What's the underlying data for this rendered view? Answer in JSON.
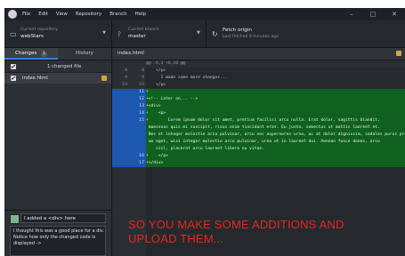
{
  "menu": [
    "File",
    "Edit",
    "View",
    "Repository",
    "Branch",
    "Help"
  ],
  "window_controls": [
    "–",
    "□",
    "✕"
  ],
  "toolbar": {
    "repo_caption": "Current repository",
    "repo_value": "webStars",
    "branch_caption": "Current branch",
    "branch_value": "master",
    "fetch_title": "Fetch origin",
    "fetch_sub": "Last fetched 8 minutes ago"
  },
  "sidebar": {
    "tab_changes": "Changes",
    "tab_changes_count": "1",
    "tab_history": "History",
    "summary": "1 changed file",
    "file": "index.html",
    "commit_summary": "I added a <div> here",
    "commit_description": [
      "I thought this was a good place for a div.",
      "Notice how only the changed code is",
      "displayed ->"
    ]
  },
  "diff": {
    "filename": "index.html",
    "hunk": "@@ -8,3 +8,10 @@",
    "lines": [
      {
        "old": "8",
        "new": "8",
        "text": "    </p>",
        "type": "ctx"
      },
      {
        "old": "9",
        "new": "9",
        "text": "      I made some more changes...",
        "type": "ctx"
      },
      {
        "old": "10",
        "new": "10",
        "text": "    </p>",
        "type": "ctx"
      },
      {
        "old": "",
        "new": "11",
        "text": "+",
        "type": "add"
      },
      {
        "old": "",
        "new": "12",
        "text": "+<!-- Later on... -->",
        "type": "add"
      },
      {
        "old": "",
        "new": "13",
        "text": "+<div>",
        "type": "add"
      },
      {
        "old": "",
        "new": "14",
        "text": "+    <p>",
        "type": "add"
      },
      {
        "old": "",
        "new": "15",
        "text": "+        Lorem ipsum dolor sit amet, pretium facilisi arcu nulla. Erat dolor, sagittis blandit,",
        "type": "add"
      },
      {
        "old": "",
        "new": "",
        "text": " maecenas quis mi suscipit, risus enim tincidunt erat. Eu justo, semectus ut mattis laoreet et.",
        "type": "addcont"
      },
      {
        "old": "",
        "new": "",
        "text": " Nec et integer molestie arcu pulvinar, arcu nec aspernores urna, ac at dolor dignissim, sodales purus pretium",
        "type": "addcont"
      },
      {
        "old": "",
        "new": "",
        "text": " um eget, wisi integer molestie arcu pulvinar, urna ut in laoreet dui. Aenean fusce donec, arcu",
        "type": "addcont"
      },
      {
        "old": "",
        "new": "",
        "text": "    nisl, placerat arcu laoreet libero eu vitae.",
        "type": "addcont"
      },
      {
        "old": "",
        "new": "16",
        "text": "+    </p>",
        "type": "add"
      },
      {
        "old": "",
        "new": "17",
        "text": "+</div>",
        "type": "add"
      }
    ]
  },
  "overlay": [
    "SO YOU MAKE SOME ADDITIONS AND",
    "UPLOAD THEM..."
  ],
  "colors": {
    "accent": "#2f81f7",
    "added_bg": "#10611f",
    "gutter_added": "#1c57b0",
    "overlay_text": "#e8251c",
    "badge_modified": "#d8a13a"
  }
}
